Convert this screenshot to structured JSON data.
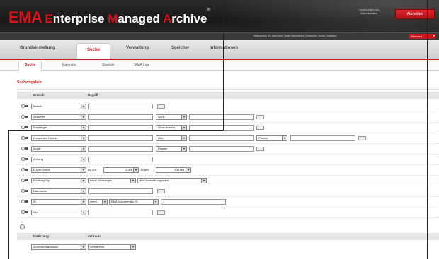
{
  "header": {
    "logo_ema": "EMA",
    "logo_words": [
      {
        "cap": "E",
        "rest": "nterprise "
      },
      {
        "cap": "M",
        "rest": "anaged "
      },
      {
        "cap": "A",
        "rest": "rchive"
      }
    ],
    "logo_tm": "®",
    "user_line1": "Angemeldet als",
    "user_line2": "Administrator",
    "logout_label": "Abmelden",
    "status_message": "Willkommen. Es sind keine neuen Nachrichten vorhanden. Archiv: Standard",
    "archive_select": "Standard"
  },
  "main_tabs": [
    {
      "label": "Grundeinstellung"
    },
    {
      "label": "Suche"
    },
    {
      "label": "Verwaltung"
    },
    {
      "label": "Speicher"
    },
    {
      "label": "Informationen"
    }
  ],
  "sub_tabs": [
    {
      "label": "Suche"
    },
    {
      "label": "Kalender"
    },
    {
      "label": "Statistik"
    },
    {
      "label": "EMA Log"
    }
  ],
  "search": {
    "title": "Suchvorgaben",
    "col_bereich": "Bereich",
    "col_begriff": "Begriff",
    "rows": [
      {
        "field": "Betreff",
        "term": ""
      },
      {
        "field": "Absender",
        "term": "",
        "op": "Ohne"
      },
      {
        "field": "Empfänger",
        "term": "",
        "op": "Ohne Ansicht"
      },
      {
        "field": "Komplettes Header",
        "term": "",
        "op": "Oder",
        "extra": "Platzen"
      },
      {
        "field": "Inhalt",
        "term": "",
        "op": "Platzen"
      },
      {
        "field": "Anhang",
        "term": ""
      },
      {
        "field": "E-Mail Größe",
        "from_label": "Ab aus",
        "from_value": "10 kB",
        "to_label": "Bf aus",
        "to_value": "100 MB"
      },
      {
        "field": "Richtung/Typ",
        "direction": "beide Richtungen",
        "type": "alle Übermittlungsarten"
      },
      {
        "field": "Datenarea",
        "term": ""
      },
      {
        "field": "ID",
        "id_scope": "intern",
        "id_type": "EMA Dokumenten ID",
        "id_value": "1"
      },
      {
        "field": "Alle",
        "term": ""
      }
    ],
    "sort_label": "Sortierung",
    "sort_value": "Archivierungsdatum",
    "order_label": "Zeitraum",
    "order_value": "unbegrenzt"
  }
}
